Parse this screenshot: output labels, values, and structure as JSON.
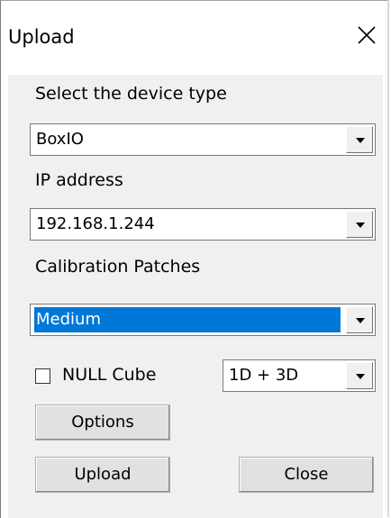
{
  "window": {
    "title": "Upload"
  },
  "icons": {
    "close": "close-icon",
    "dropdown": "chevron-down-icon"
  },
  "device_type": {
    "label": "Select the device type",
    "value": "BoxIO"
  },
  "ip_address": {
    "label": "IP address",
    "value": "192.168.1.244"
  },
  "calibration": {
    "label": "Calibration Patches",
    "value": "Medium",
    "selected": true
  },
  "null_cube": {
    "label": "NULL Cube",
    "checked": false
  },
  "lut_mode": {
    "value": "1D + 3D"
  },
  "buttons": {
    "options": "Options",
    "upload": "Upload",
    "close": "Close"
  },
  "colors": {
    "selection": "#0078d7",
    "dialog_bg": "#f0f0f0",
    "button_bg": "#e1e1e1"
  }
}
